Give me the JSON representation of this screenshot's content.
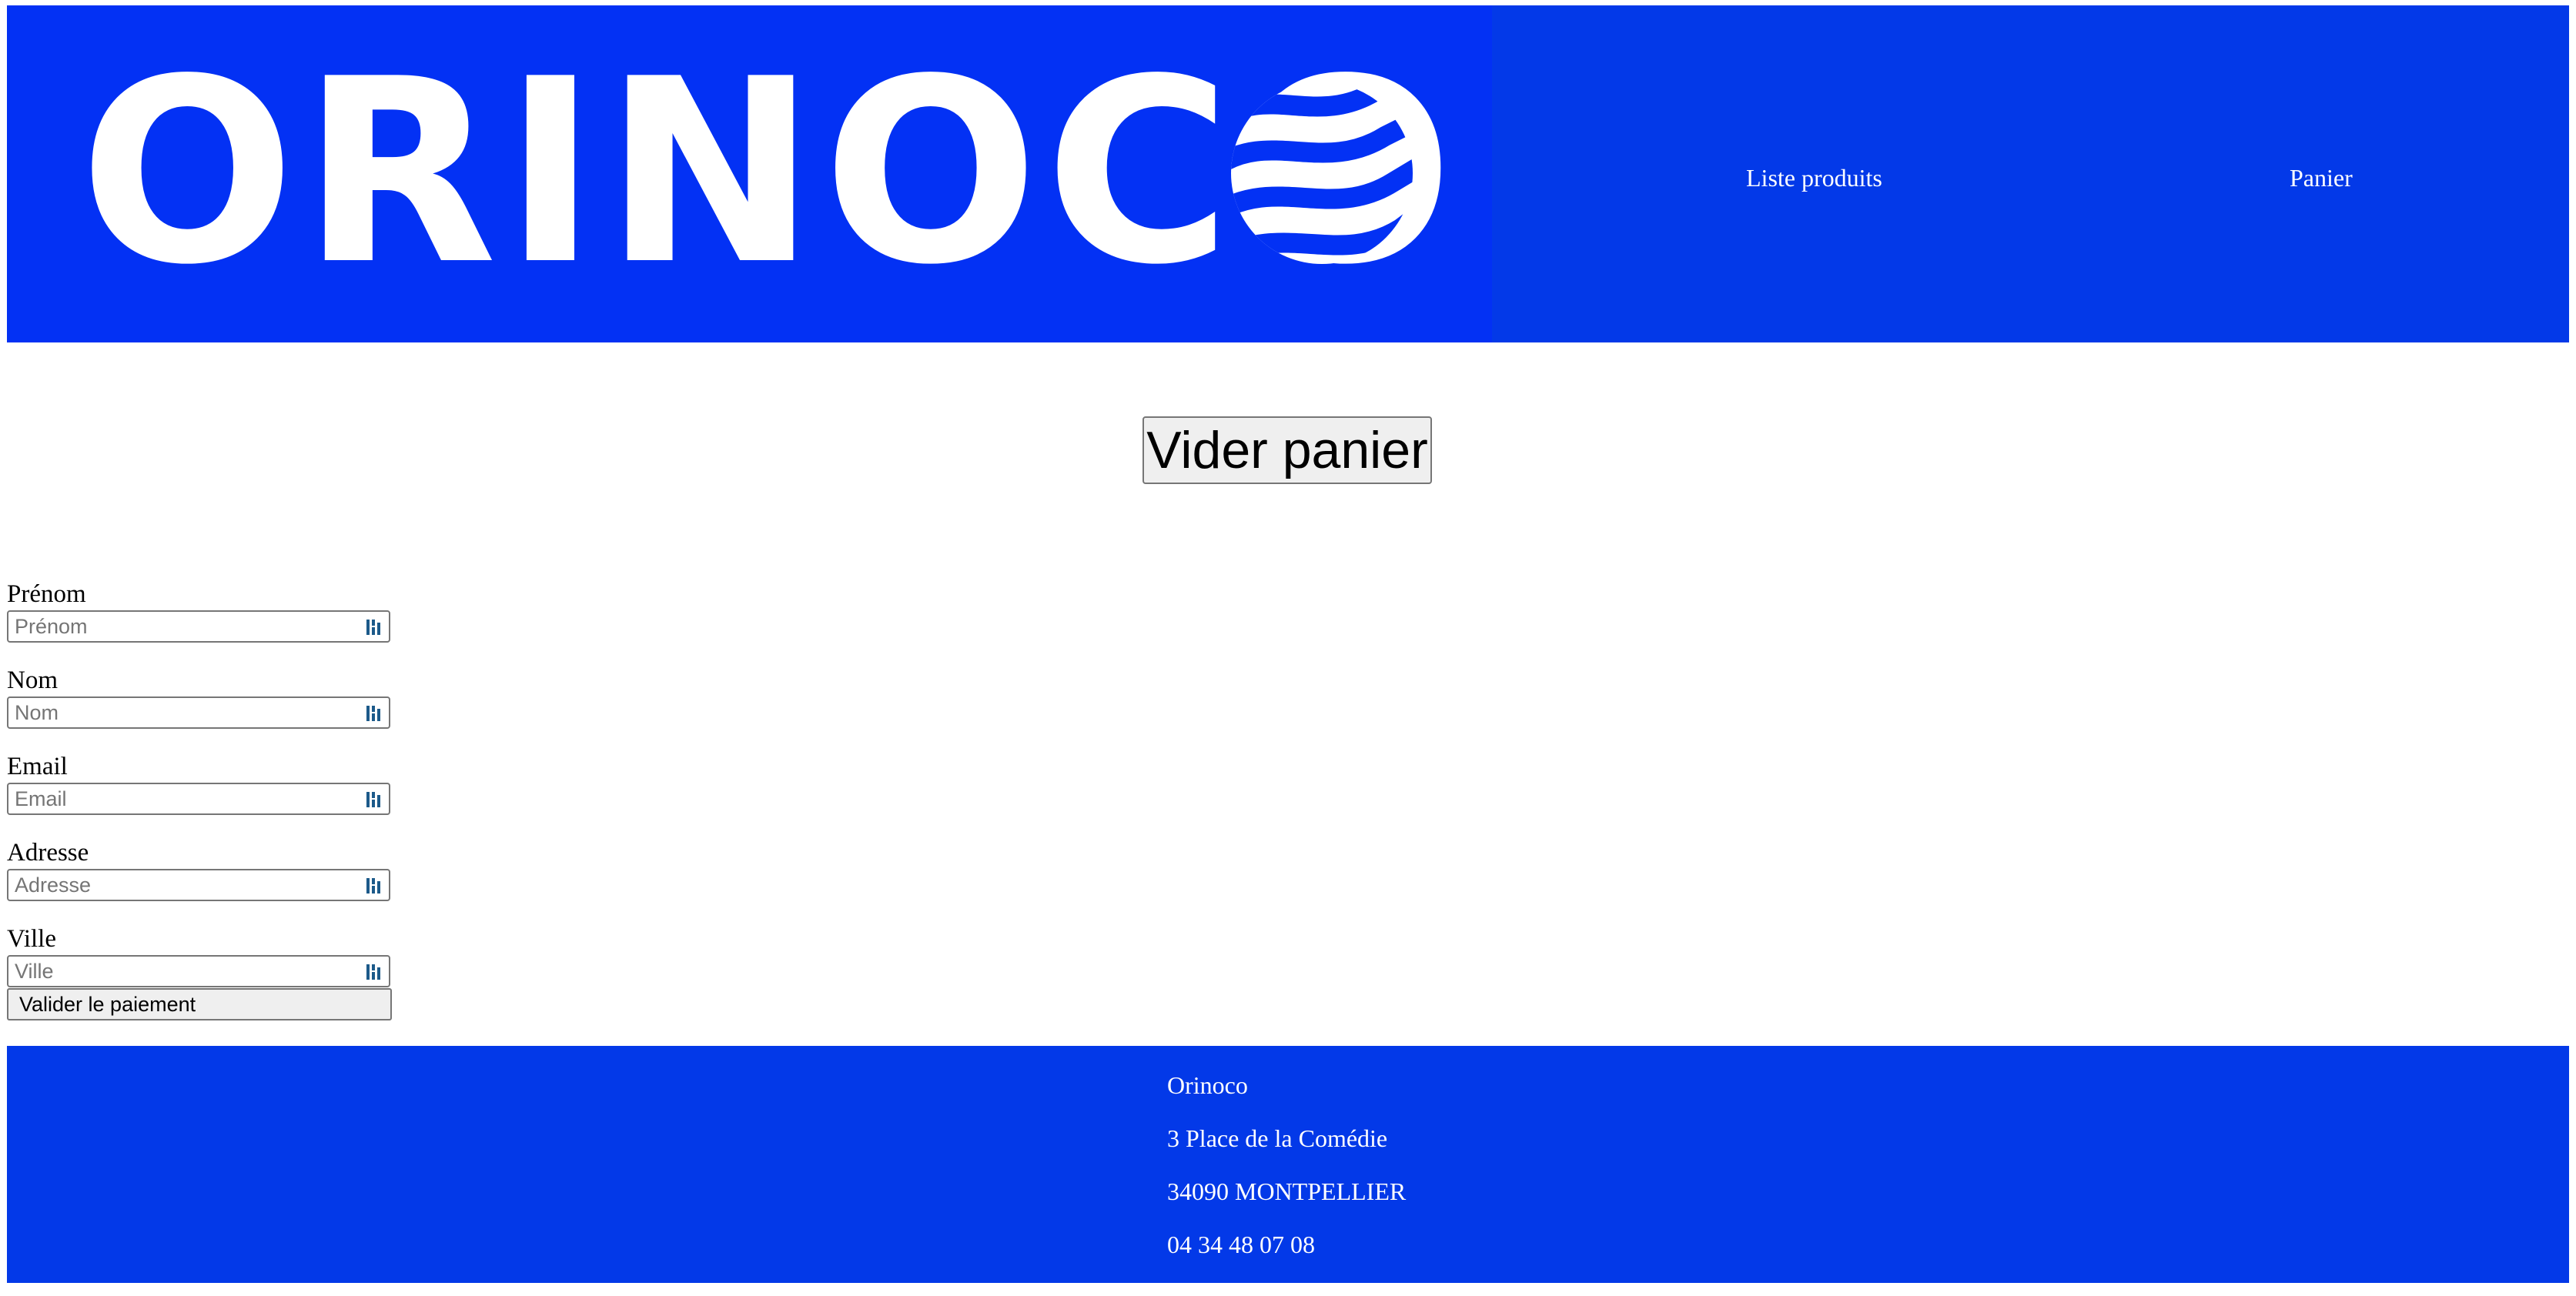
{
  "brand": {
    "logo_text": "ORINOCO",
    "logo_bg_color": "#0331f4",
    "header_color": "#0339e8"
  },
  "nav": {
    "items": [
      {
        "label": "Liste produits"
      },
      {
        "label": "Panier"
      }
    ]
  },
  "cart": {
    "empty_button_label": "Vider panier"
  },
  "form": {
    "fields": [
      {
        "label": "Prénom",
        "placeholder": "Prénom",
        "value": ""
      },
      {
        "label": "Nom",
        "placeholder": "Nom",
        "value": ""
      },
      {
        "label": "Email",
        "placeholder": "Email",
        "value": ""
      },
      {
        "label": "Adresse",
        "placeholder": "Adresse",
        "value": ""
      },
      {
        "label": "Ville",
        "placeholder": "Ville",
        "value": ""
      }
    ],
    "field_icon": "password-manager-icon",
    "submit_label": "Valider le paiement"
  },
  "footer": {
    "lines": [
      "Orinoco",
      "3 Place de la Comédie",
      "34090 MONTPELLIER",
      "04 34 48 07 08"
    ]
  }
}
